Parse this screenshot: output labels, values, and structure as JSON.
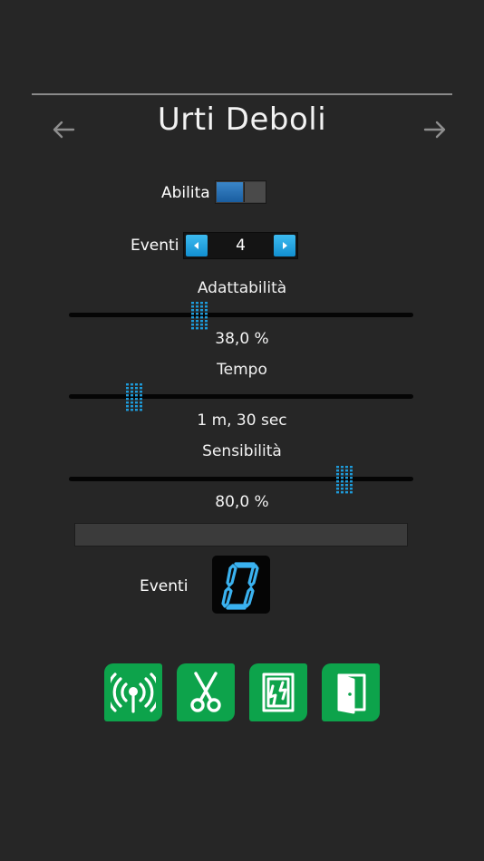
{
  "header": {
    "title": "Urti Deboli"
  },
  "enable": {
    "label": "Abilita",
    "on": true
  },
  "events_stepper": {
    "label": "Eventi",
    "value": "4"
  },
  "sliders": [
    {
      "label": "Adattabilità",
      "value_text": "38,0 %",
      "fraction": 0.38
    },
    {
      "label": "Tempo",
      "value_text": "1 m, 30 sec",
      "fraction": 0.19
    },
    {
      "label": "Sensibilità",
      "value_text": "80,0 %",
      "fraction": 0.8
    }
  ],
  "progress": {
    "fraction": 0.0
  },
  "counter": {
    "label": "Eventi",
    "digit": "0"
  },
  "icons": {
    "prev": "arrow-left-icon",
    "next": "arrow-right-icon",
    "buttons": [
      "antenna-signal-icon",
      "scissors-icon",
      "broken-glass-window-icon",
      "open-door-icon"
    ]
  },
  "colors": {
    "accent": "#1e9ad8",
    "button_green": "#0da34b",
    "background": "#262626"
  }
}
